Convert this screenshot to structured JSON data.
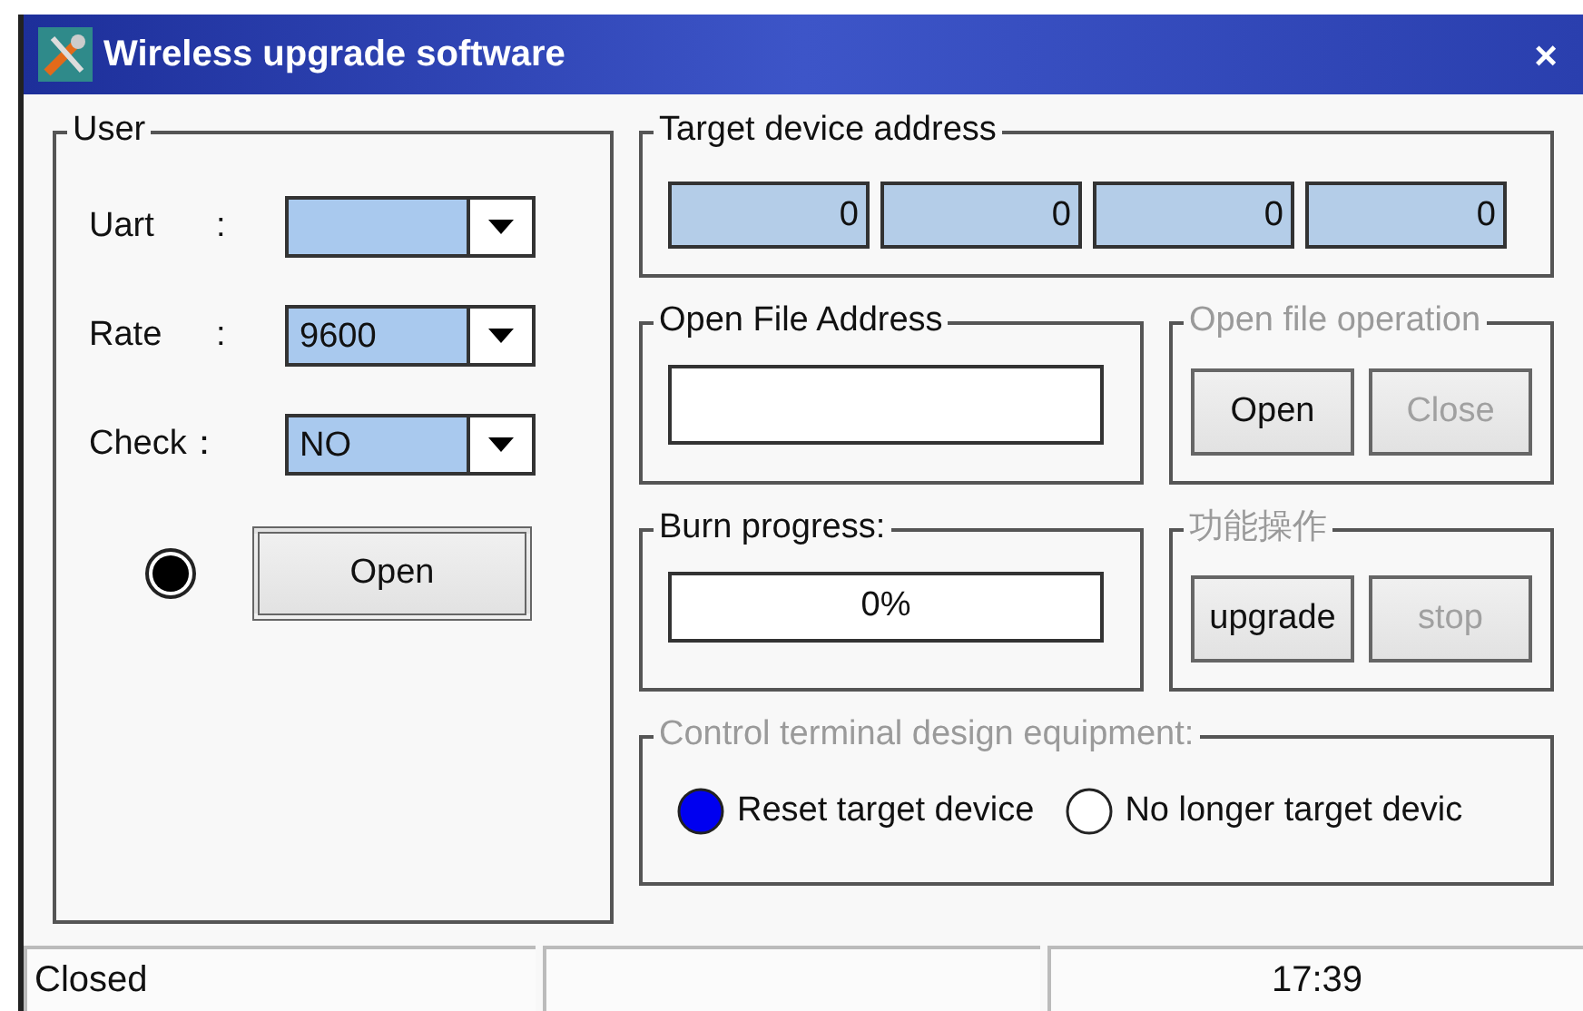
{
  "window": {
    "title": "Wireless upgrade software",
    "close": "×"
  },
  "user": {
    "title": "User",
    "fields": [
      {
        "label": "Uart",
        "separator": ":"
      },
      {
        "label": "Rate",
        "separator": ":",
        "value": "9600"
      },
      {
        "label": "Check：",
        "value": "NO"
      }
    ],
    "open_button": "Open"
  },
  "target": {
    "title": "Target device address",
    "octets": [
      "0",
      "0",
      "0",
      "0"
    ]
  },
  "file_address": {
    "title": "Open File Address"
  },
  "file_operation": {
    "title": "Open file operation",
    "disabled": true,
    "buttons": [
      {
        "label": "Open",
        "disabled": false
      },
      {
        "label": "Close",
        "disabled": true
      }
    ]
  },
  "burn": {
    "title": "Burn progress:",
    "level": 0,
    "reading": "0%"
  },
  "function_ops": {
    "title": "功能操作",
    "disabled": true,
    "buttons": [
      {
        "label": "upgrade",
        "disabled": false
      },
      {
        "label": "stop",
        "disabled": true
      }
    ]
  },
  "control": {
    "title": "Control terminal design equipment:",
    "disabled": true,
    "options": [
      {
        "label": "Reset target device",
        "selected": true
      },
      {
        "label": "No longer target devic",
        "selected": false
      }
    ]
  },
  "status_bar": {
    "state": "Closed",
    "time": "17:39"
  }
}
